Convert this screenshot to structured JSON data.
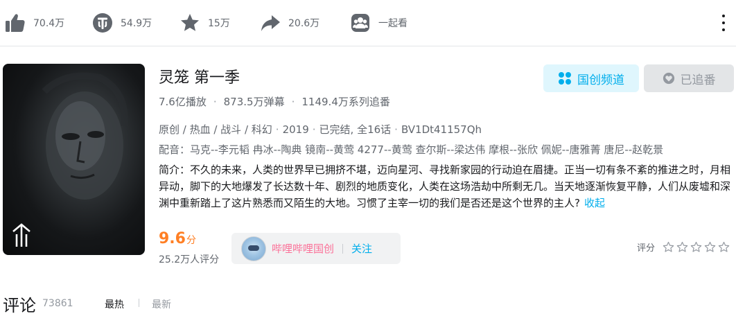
{
  "toolbar": {
    "like_count": "70.4万",
    "coin_count": "54.9万",
    "fav_count": "15万",
    "share_count": "20.6万",
    "watch_together_label": "一起看"
  },
  "series": {
    "title": "灵笼 第一季",
    "plays": "7.6亿播放",
    "danmaku": "873.5万弹幕",
    "followers": "1149.4万系列追番",
    "tags": "原创 / 热血 / 战斗 / 科幻",
    "year": "2019",
    "status": "已完结, 全16话",
    "bvid": "BV1Dt41157Qh",
    "cast": "配音：马克--李元韬 冉冰--陶典 镜南--黄莺 4277--黄莺 查尔斯--梁达伟 摩根--张欣 佩妮--唐雅菁 唐尼--赵乾景",
    "desc": "简介：不久的未来，人类的世界早已拥挤不堪，迈向星河、寻找新家园的行动迫在眉捷。正当一切有条不紊的推进之时，月相异动，脚下的大地爆发了长达数十年、剧烈的地质变化，人类在这场浩劫中所剩无几。当天地逐渐恢复平静，人们从废墟和深渊中重新踏上了这片熟悉而又陌生的大地。习惯了主宰一切的我们是否还是这个世界的主人?",
    "collapse_label": "收起"
  },
  "buttons": {
    "channel_label": "国创频道",
    "follow_label": "已追番"
  },
  "score": {
    "value": "9.6",
    "unit": "分",
    "count": "25.2万人评分"
  },
  "uploader": {
    "name": "哔哩哔哩国创",
    "follow_label": "关注"
  },
  "rating": {
    "label": "评分",
    "stars_total": 5,
    "stars_filled": 0
  },
  "comments": {
    "title": "评论",
    "count": "73861",
    "tab_hot": "最热",
    "tab_new": "最新"
  },
  "icons": {
    "like": "thumbs-up-icon",
    "coin": "coin-icon",
    "favorite": "star-icon",
    "share": "share-arrow-icon",
    "watch_together": "group-icon",
    "more": "more-vertical-icon",
    "channel": "grid-icon",
    "follow": "heart-icon"
  },
  "colors": {
    "accent": "#00aeec",
    "score": "#ff7f24",
    "uploader_name": "#fb7299",
    "icon_dark": "#61666d"
  }
}
